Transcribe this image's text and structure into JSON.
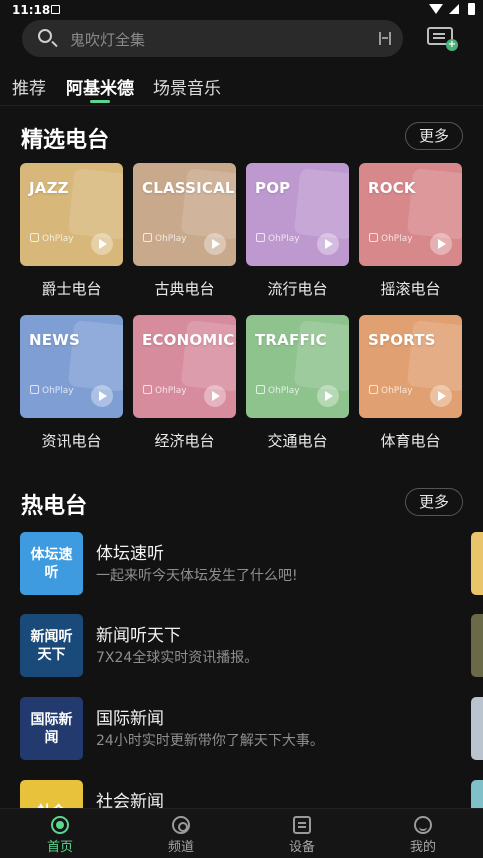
{
  "status_bar": {
    "time": "11:18"
  },
  "search": {
    "placeholder": "鬼吹灯全集"
  },
  "tabs": [
    {
      "label": "推荐",
      "active": false
    },
    {
      "label": "阿基米德",
      "active": true
    },
    {
      "label": "场景音乐",
      "active": false
    }
  ],
  "featured": {
    "title": "精选电台",
    "more_label": "更多",
    "brand": "OhPlay",
    "items": [
      {
        "cover_text": "JAZZ",
        "label": "爵士电台",
        "color": "#d7b77a"
      },
      {
        "cover_text": "CLASSICAL",
        "label": "古典电台",
        "color": "#c9a98c"
      },
      {
        "cover_text": "POP",
        "label": "流行电台",
        "color": "#bd99cf"
      },
      {
        "cover_text": "ROCK",
        "label": "摇滚电台",
        "color": "#d7888b"
      },
      {
        "cover_text": "NEWS",
        "label": "资讯电台",
        "color": "#7f9fd4"
      },
      {
        "cover_text": "ECONOMICS",
        "label": "经济电台",
        "color": "#d78c9e"
      },
      {
        "cover_text": "TRAFFIC",
        "label": "交通电台",
        "color": "#8fc38e"
      },
      {
        "cover_text": "SPORTS",
        "label": "体育电台",
        "color": "#e0a071"
      }
    ]
  },
  "hot": {
    "title": "热电台",
    "more_label": "更多",
    "items": [
      {
        "cover_text": "体坛速听",
        "title": "体坛速听",
        "desc": "一起来听今天体坛发生了什么吧!",
        "color": "#3f9be0"
      },
      {
        "cover_text": "新闻听天下",
        "title": "新闻听天下",
        "desc": "7X24全球实时资讯播报。",
        "color": "#1a4a7a"
      },
      {
        "cover_text": "国际新闻",
        "title": "国际新闻",
        "desc": "24小时实时更新带你了解天下大事。",
        "color": "#233a6e"
      },
      {
        "cover_text": "社会",
        "title": "社会新闻",
        "desc": "",
        "color": "#e8c23a"
      }
    ]
  },
  "bottom_nav": [
    {
      "label": "首页",
      "icon": "home-disc-icon",
      "active": true
    },
    {
      "label": "频道",
      "icon": "channel-icon",
      "active": false
    },
    {
      "label": "设备",
      "icon": "radio-device-icon",
      "active": false
    },
    {
      "label": "我的",
      "icon": "smile-face-icon",
      "active": false
    }
  ],
  "colors": {
    "accent": "#5cd68f",
    "background": "#121212"
  }
}
